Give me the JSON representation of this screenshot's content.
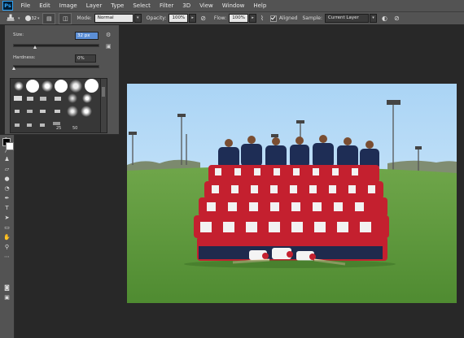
{
  "app": {
    "logo": "Ps"
  },
  "menu": [
    "File",
    "Edit",
    "Image",
    "Layer",
    "Type",
    "Select",
    "Filter",
    "3D",
    "View",
    "Window",
    "Help"
  ],
  "options_bar": {
    "brush_size": "32",
    "mode_label": "Mode:",
    "mode_value": "Normal",
    "opacity_label": "Opacity:",
    "opacity_value": "100%",
    "flow_label": "Flow:",
    "flow_value": "100%",
    "aligned_label": "Aligned",
    "sample_label": "Sample:",
    "sample_value": "Current Layer"
  },
  "brush_panel": {
    "size_label": "Size:",
    "size_value": "32 px",
    "hardness_label": "Hardness:",
    "hardness_value": "0%",
    "preset_numbers": [
      "25",
      "50"
    ]
  },
  "icons": [
    "clone-stamp-icon",
    "brush-preset-icon",
    "clone-source-icon",
    "pressure-opacity-icon",
    "airbrush-icon",
    "ignore-adjustment-icon",
    "pressure-size-icon",
    "gear-icon",
    "new-preset-icon"
  ],
  "colors": {
    "menubar": "#535353",
    "app_bg": "#282828",
    "selection": "#5c8fd6",
    "foreground_swatch": "#000000",
    "background_swatch": "#ffffff"
  }
}
